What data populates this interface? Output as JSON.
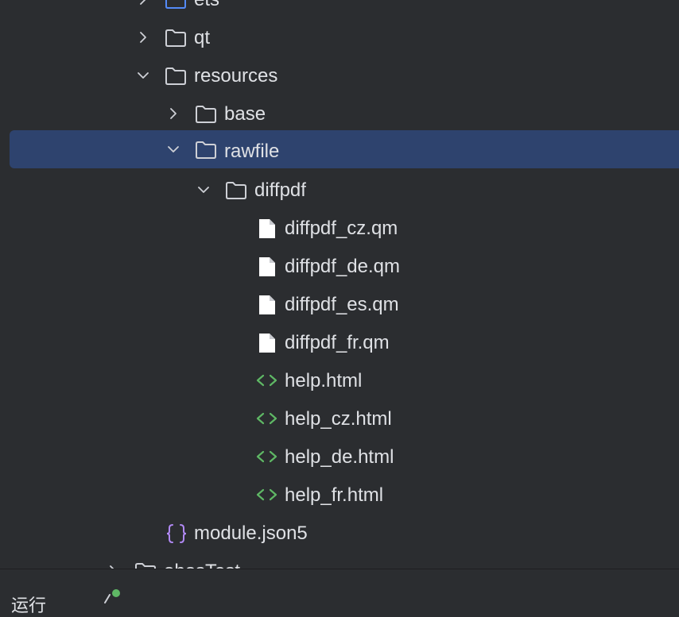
{
  "tree": {
    "items": [
      {
        "label": "ets",
        "type": "folder",
        "expanded": false,
        "icon": "folder-icon-blue"
      },
      {
        "label": "qt",
        "type": "folder",
        "expanded": false,
        "icon": "folder-icon"
      },
      {
        "label": "resources",
        "type": "folder",
        "expanded": true,
        "icon": "folder-icon"
      },
      {
        "label": "base",
        "type": "folder",
        "expanded": false,
        "icon": "folder-icon"
      },
      {
        "label": "rawfile",
        "type": "folder",
        "expanded": true,
        "selected": true,
        "icon": "folder-icon"
      },
      {
        "label": "diffpdf",
        "type": "folder",
        "expanded": true,
        "icon": "folder-icon"
      },
      {
        "label": "diffpdf_cz.qm",
        "type": "file",
        "icon": "file-icon"
      },
      {
        "label": "diffpdf_de.qm",
        "type": "file",
        "icon": "file-icon"
      },
      {
        "label": "diffpdf_es.qm",
        "type": "file",
        "icon": "file-icon"
      },
      {
        "label": "diffpdf_fr.qm",
        "type": "file",
        "icon": "file-icon"
      },
      {
        "label": "help.html",
        "type": "html",
        "icon": "html-icon"
      },
      {
        "label": "help_cz.html",
        "type": "html",
        "icon": "html-icon"
      },
      {
        "label": "help_de.html",
        "type": "html",
        "icon": "html-icon"
      },
      {
        "label": "help_fr.html",
        "type": "html",
        "icon": "html-icon"
      },
      {
        "label": "module.json5",
        "type": "json",
        "icon": "json-icon"
      },
      {
        "label": "ohosTest",
        "type": "folder",
        "expanded": false,
        "icon": "folder-icon"
      }
    ]
  },
  "colors": {
    "background": "#2b2d30",
    "selection": "#2e436e",
    "text": "#dfe1e5",
    "icon_gray": "#ced0d6",
    "html_green": "#5fb865",
    "json_purple": "#b189f5",
    "folder_blue": "#548af7",
    "status_green": "#5fb865"
  },
  "bottom": {
    "partial_label": "运行"
  }
}
